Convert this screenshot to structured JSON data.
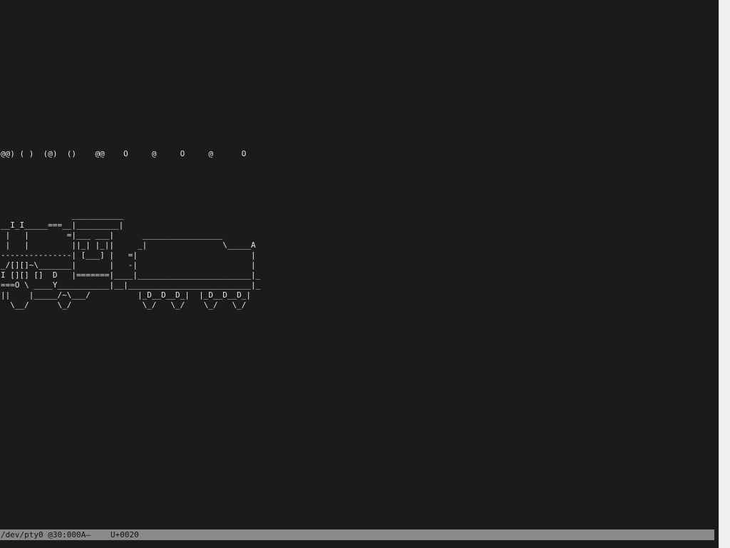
{
  "terminal": {
    "smoke_line": "@@) ( )  (@)  ()    @@    O     @     O     @      O",
    "train_lines": [
      "               ___________",
      "__I_I_____===__|_________|",
      " |   |        =|___ ___|      _________________",
      " |   |         ||_| |_||     _|                \\_____A",
      "---------------| [___] |   =|                        |",
      "_/[][]~\\_______|       |   -|                        |",
      "I [][] []  D   |=======|____|________________________|_",
      "===O \\ ____Y___________|__|__________________________|_",
      "||    |_____/~\\___/          |_D__D__D_|  |_D__D__D_|",
      "  \\__/      \\_/               \\_/   \\_/    \\_/   \\_/"
    ]
  },
  "status_bar": {
    "device": "/dev/pty0 @30:000A—",
    "codepoint": "U+0020"
  }
}
